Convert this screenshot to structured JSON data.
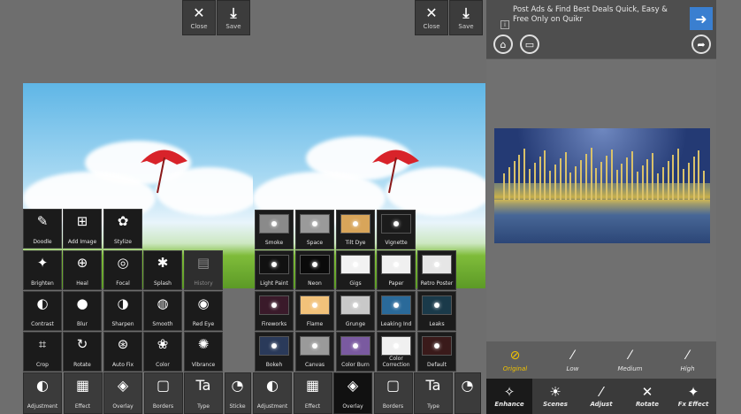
{
  "panel1": {
    "toolbar": {
      "close_label": "Close",
      "save_label": "Save"
    },
    "tiles": [
      {
        "label": "Doodle",
        "icon": "doodle-icon",
        "glyph": "✎"
      },
      {
        "label": "Add Image",
        "icon": "add-image-icon",
        "glyph": "⊞"
      },
      {
        "label": "Stylize",
        "icon": "stylize-icon",
        "glyph": "✿"
      },
      {
        "label": "Brighten",
        "icon": "brighten-icon",
        "glyph": "✦"
      },
      {
        "label": "Heal",
        "icon": "heal-icon",
        "glyph": "⊕"
      },
      {
        "label": "Focal",
        "icon": "focal-icon",
        "glyph": "◎"
      },
      {
        "label": "Splash",
        "icon": "splash-icon",
        "glyph": "✱"
      },
      {
        "label": "History",
        "icon": "history-icon",
        "glyph": "▤"
      },
      {
        "label": "Contrast",
        "icon": "contrast-icon",
        "glyph": "◐"
      },
      {
        "label": "Blur",
        "icon": "blur-icon",
        "glyph": "●"
      },
      {
        "label": "Sharpen",
        "icon": "sharpen-icon",
        "glyph": "◑"
      },
      {
        "label": "Smooth",
        "icon": "smooth-icon",
        "glyph": "◍"
      },
      {
        "label": "Red Eye",
        "icon": "red-eye-icon",
        "glyph": "◉"
      },
      {
        "label": "Crop",
        "icon": "crop-icon",
        "glyph": "⌗"
      },
      {
        "label": "Rotate",
        "icon": "rotate-icon",
        "glyph": "↻"
      },
      {
        "label": "Auto Fix",
        "icon": "auto-fix-icon",
        "glyph": "⊛"
      },
      {
        "label": "Color",
        "icon": "color-icon",
        "glyph": "❀"
      },
      {
        "label": "Vibrance",
        "icon": "vibrance-icon",
        "glyph": "✺"
      }
    ],
    "bottom": [
      {
        "label": "Adjustment",
        "icon": "adjustment-icon",
        "glyph": "◐"
      },
      {
        "label": "Effect",
        "icon": "effect-icon",
        "glyph": "▦"
      },
      {
        "label": "Overlay",
        "icon": "overlay-icon",
        "glyph": "◈"
      },
      {
        "label": "Borders",
        "icon": "borders-icon",
        "glyph": "▢"
      },
      {
        "label": "Type",
        "icon": "type-icon",
        "glyph": "Ta"
      },
      {
        "label": "Sticke",
        "icon": "sticker-icon",
        "glyph": "◔"
      }
    ]
  },
  "panel2": {
    "toolbar": {
      "close_label": "Close",
      "save_label": "Save"
    },
    "tiles": [
      {
        "label": "Smoke",
        "bg": "#8a8a8a"
      },
      {
        "label": "Space",
        "bg": "#9a9a9a"
      },
      {
        "label": "Tilt Dye",
        "bg": "#d8a55a"
      },
      {
        "label": "Vignette",
        "bg": "#1b1b1b"
      },
      {
        "label": "Light Paint",
        "bg": "#111111"
      },
      {
        "label": "Neon",
        "bg": "#0a0a0a"
      },
      {
        "label": "Gigs",
        "bg": "#f2f2f2"
      },
      {
        "label": "Paper",
        "bg": "#f0f0f0"
      },
      {
        "label": "Retro Poster",
        "bg": "#e6e6e6"
      },
      {
        "label": "Fireworks",
        "bg": "#3a1a2a"
      },
      {
        "label": "Flame",
        "bg": "#f2c27a"
      },
      {
        "label": "Grunge",
        "bg": "#c8c8c8"
      },
      {
        "label": "Leaking Ind",
        "bg": "#2a6a9a"
      },
      {
        "label": "Leaks",
        "bg": "#1a3a4a"
      },
      {
        "label": "Bokeh",
        "bg": "#2a3a5a"
      },
      {
        "label": "Canvas",
        "bg": "#9a9a9a"
      },
      {
        "label": "Color Burn",
        "bg": "#7a5aa0"
      },
      {
        "label": "Color Correction",
        "bg": "#f0f0f0"
      },
      {
        "label": "Default",
        "bg": "#3a1a1a"
      }
    ],
    "bottom": [
      {
        "label": "Adjustment",
        "icon": "adjustment-icon",
        "glyph": "◐"
      },
      {
        "label": "Effect",
        "icon": "effect-icon",
        "glyph": "▦"
      },
      {
        "label": "Overlay",
        "icon": "overlay-icon",
        "glyph": "◈"
      },
      {
        "label": "Borders",
        "icon": "borders-icon",
        "glyph": "▢"
      },
      {
        "label": "Type",
        "icon": "type-icon",
        "glyph": "Ta"
      },
      {
        "label": "",
        "icon": "sticker-icon",
        "glyph": "◔"
      }
    ]
  },
  "panel3": {
    "ad_text": "Post Ads & Find Best Deals Quick, Easy & Free Only on Quikr",
    "ad_info": "i",
    "options": [
      {
        "label": "Original",
        "icon": "original-icon",
        "glyph": "⊘"
      },
      {
        "label": "Low",
        "icon": "low-wand-icon",
        "glyph": "⁄"
      },
      {
        "label": "Medium",
        "icon": "medium-wand-icon",
        "glyph": "⁄"
      },
      {
        "label": "High",
        "icon": "high-wand-icon",
        "glyph": "⁄"
      }
    ],
    "tabs": [
      {
        "label": "Enhance",
        "icon": "enhance-icon",
        "glyph": "✧"
      },
      {
        "label": "Scenes",
        "icon": "scenes-icon",
        "glyph": "☀"
      },
      {
        "label": "Adjust",
        "icon": "adjust-icon",
        "glyph": "⁄"
      },
      {
        "label": "Rotate",
        "icon": "rotate-icon",
        "glyph": "✕"
      },
      {
        "label": "Fx Effect",
        "icon": "fx-effect-icon",
        "glyph": "✦"
      }
    ]
  },
  "colors": {
    "accent": "#f2c300",
    "ad_button": "#3a7fd0",
    "umbrella": "#d8232a"
  }
}
